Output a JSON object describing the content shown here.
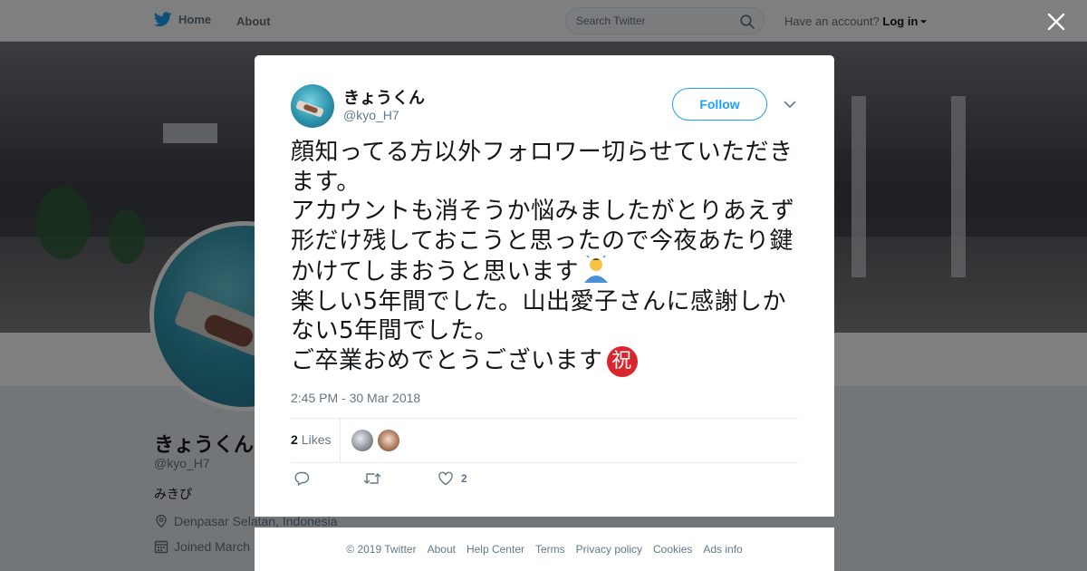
{
  "nav": {
    "home_label": "Home",
    "about_label": "About",
    "search_placeholder": "Search Twitter",
    "account_prompt": "Have an account?",
    "login_label": "Log in"
  },
  "profile": {
    "name": "きょうくん",
    "handle": "@kyo_H7",
    "bio": "みきぴ",
    "location": "Denpasar Selatan, Indonesia",
    "joined": "Joined March"
  },
  "tweet": {
    "author_name": "きょうくん",
    "author_handle": "@kyo_H7",
    "follow_label": "Follow",
    "text_part1": "顔知ってる方以外フォロワー切らせていただきます。\nアカウントも消そうか悩みましたがとりあえず形だけ残しておこうと思ったので今夜あたり鍵かけてしまおうと思います",
    "text_part2": "\n楽しい5年間でした。山出愛子さんに感謝しかない5年間でした。\nご卒業おめでとうございます",
    "celebrate_glyph": "祝",
    "timestamp": "2:45 PM - 30 Mar 2018",
    "likes_count": "2",
    "likes_label": "Likes",
    "like_action_count": "2"
  },
  "footer": {
    "links": [
      "© 2019 Twitter",
      "About",
      "Help Center",
      "Terms",
      "Privacy policy",
      "Cookies",
      "Ads info"
    ]
  },
  "colors": {
    "brand": "#1da1f2",
    "overlay": "rgba(0,0,0,0.5)",
    "text_primary": "#14171a",
    "text_secondary": "#657786"
  },
  "icons": {
    "logo": "twitter-bird-icon",
    "search": "search-icon",
    "close": "close-icon",
    "menu": "chevron-down-icon",
    "reply": "reply-icon",
    "retweet": "retweet-icon",
    "like": "heart-icon",
    "location": "location-pin-icon",
    "calendar": "calendar-icon",
    "emoji_person": "person-bowing-emoji-icon",
    "emoji_celebrate": "celebration-emoji-icon"
  }
}
